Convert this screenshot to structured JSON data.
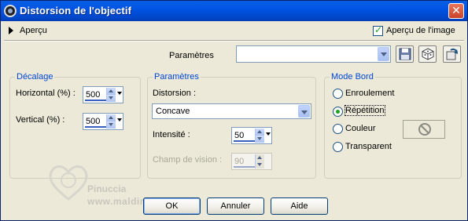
{
  "window": {
    "title": "Distorsion de l'objectif",
    "close_glyph": "✕"
  },
  "preview": {
    "expand_label": "Aperçu",
    "checkbox_label": "Aperçu de l'image",
    "checkbox_checked": true
  },
  "presets": {
    "label": "Paramètres",
    "value": ""
  },
  "toolbar": {
    "icons": [
      "save-icon",
      "randomize-icon",
      "reset-icon"
    ]
  },
  "offset_group": {
    "title": "Décalage",
    "horizontal_label": "Horizontal (%) :",
    "horizontal_value": "500",
    "vertical_label": "Vertical (%) :",
    "vertical_value": "500"
  },
  "params_group": {
    "title": "Paramètres",
    "distortion_label": "Distorsion :",
    "distortion_value": "Concave",
    "intensity_label": "Intensité :",
    "intensity_value": "50",
    "fov_label": "Champ de vision :",
    "fov_value": "90"
  },
  "edge_group": {
    "title": "Mode Bord",
    "options": [
      "Enroulement",
      "Répétition",
      "Couleur",
      "Transparent"
    ],
    "selected": "Répétition"
  },
  "watermark": {
    "name": "Pinuccia",
    "site": "www.maldiregrafica.eu"
  },
  "buttons": {
    "ok": "OK",
    "cancel": "Annuler",
    "help": "Aide"
  },
  "colors": {
    "title_bar": "#0054e3",
    "group_title": "#0046d5",
    "dialog_bg": "#ece9d8"
  }
}
